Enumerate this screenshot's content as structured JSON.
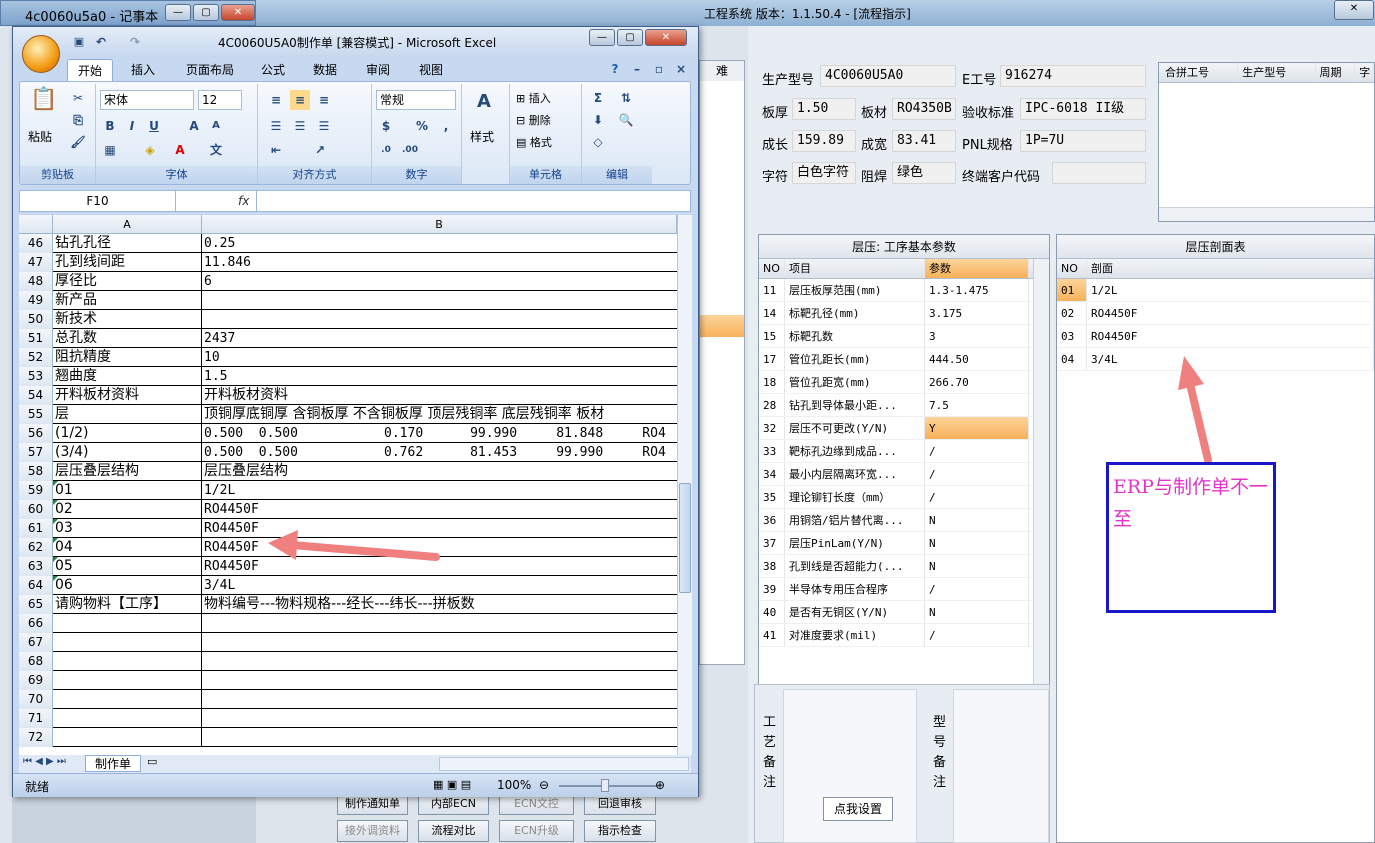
{
  "notepad": {
    "title": "4c0060u5a0 - 记事本"
  },
  "app": {
    "title": "工程系统  版本：1.1.50.4 - [流程指示]"
  },
  "excel": {
    "title": "4C0060U5A0制作单 [兼容模式] - Microsoft Excel",
    "tabs": [
      "开始",
      "插入",
      "页面布局",
      "公式",
      "数据",
      "审阅",
      "视图"
    ],
    "groups": [
      "剪贴板",
      "字体",
      "对齐方式",
      "数字",
      "单元格",
      "编辑"
    ],
    "paste": "粘贴",
    "font": "宋体",
    "font_size": "12",
    "number_format": "常规",
    "styles": "样式",
    "insert": "插入",
    "delete": "删除",
    "format": "格式",
    "name_box": "F10",
    "fx": "fx",
    "col_a": "A",
    "col_b": "B",
    "rows": [
      {
        "n": "46",
        "a": "钻孔孔径",
        "b": "0.25"
      },
      {
        "n": "47",
        "a": "孔到线间距",
        "b": "11.846"
      },
      {
        "n": "48",
        "a": "厚径比",
        "b": "6"
      },
      {
        "n": "49",
        "a": "新产品",
        "b": ""
      },
      {
        "n": "50",
        "a": "新技术",
        "b": ""
      },
      {
        "n": "51",
        "a": "总孔数",
        "b": "2437"
      },
      {
        "n": "52",
        "a": "阻抗精度",
        "b": "10"
      },
      {
        "n": "53",
        "a": "翘曲度",
        "b": "1.5"
      },
      {
        "n": "54",
        "a": "开料板材资料",
        "b": "开料板材资料"
      },
      {
        "n": "55",
        "a": "层",
        "b": "顶铜厚底铜厚 含铜板厚 不含铜板厚 顶层残铜率 底层残铜率 板材"
      },
      {
        "n": "56",
        "a": "(1/2)",
        "b": "0.500  0.500           0.170      99.990     81.848     RO4"
      },
      {
        "n": "57",
        "a": "(3/4)",
        "b": "0.500  0.500           0.762      81.453     99.990     RO4"
      },
      {
        "n": "58",
        "a": "层压叠层结构",
        "b": "层压叠层结构"
      },
      {
        "n": "59",
        "a": "01",
        "b": "1/2L"
      },
      {
        "n": "60",
        "a": "02",
        "b": "RO4450F"
      },
      {
        "n": "61",
        "a": "03",
        "b": "RO4450F"
      },
      {
        "n": "62",
        "a": "04",
        "b": "RO4450F"
      },
      {
        "n": "63",
        "a": "05",
        "b": "RO4450F"
      },
      {
        "n": "64",
        "a": "06",
        "b": "3/4L"
      },
      {
        "n": "65",
        "a": "请购物料【工序】",
        "b": "物料编号---物料规格---经长---纬长---拼板数"
      },
      {
        "n": "66",
        "a": "",
        "b": ""
      },
      {
        "n": "67",
        "a": "",
        "b": ""
      },
      {
        "n": "68",
        "a": "",
        "b": ""
      },
      {
        "n": "69",
        "a": "",
        "b": ""
      },
      {
        "n": "70",
        "a": "",
        "b": ""
      },
      {
        "n": "71",
        "a": "",
        "b": ""
      },
      {
        "n": "72",
        "a": "",
        "b": ""
      }
    ],
    "sheet_tab": "制作单",
    "status": "就绪",
    "zoom": "100%"
  },
  "eng": {
    "fields": {
      "model_l": "生产型号",
      "model_v": "4C0060U5A0",
      "emp_l": "E工号",
      "emp_v": "916274",
      "thick_l": "板厚",
      "thick_v": "1.50",
      "mat_l": "板材",
      "mat_v": "RO4350B",
      "std_l": "验收标准",
      "std_v": "IPC-6018 II级",
      "len_l": "成长",
      "len_v": "159.89",
      "wid_l": "成宽",
      "wid_v": "83.41",
      "pnl_l": "PNL规格",
      "pnl_v": "1P=7U",
      "char_l": "字符",
      "char_v": "白色字符",
      "mask_l": "阻焊",
      "mask_v": "绿色",
      "cust_l": "终端客户代码",
      "cust_v": ""
    },
    "top_grid_headers": [
      "合拼工号",
      "生产型号",
      "周期",
      "字"
    ],
    "params": {
      "title": "层压: 工序基本参数",
      "headers": [
        "NO",
        "项目",
        "参数"
      ],
      "rows": [
        {
          "no": "11",
          "item": "层压板厚范围(mm)",
          "val": "1.3-1.475"
        },
        {
          "no": "14",
          "item": "标靶孔径(mm)",
          "val": "3.175"
        },
        {
          "no": "15",
          "item": "标靶孔数",
          "val": "3"
        },
        {
          "no": "17",
          "item": "管位孔距长(mm)",
          "val": "444.50"
        },
        {
          "no": "18",
          "item": "管位孔距宽(mm)",
          "val": "266.70"
        },
        {
          "no": "28",
          "item": "钻孔到导体最小距...",
          "val": "7.5"
        },
        {
          "no": "32",
          "item": "层压不可更改(Y/N)",
          "val": "Y"
        },
        {
          "no": "33",
          "item": "靶标孔边缘到成品...",
          "val": "/"
        },
        {
          "no": "34",
          "item": "最小内层隔离环宽...",
          "val": "/"
        },
        {
          "no": "35",
          "item": "理论铆钉长度（mm）",
          "val": "/"
        },
        {
          "no": "36",
          "item": "用铜箔/铝片替代离...",
          "val": "N"
        },
        {
          "no": "37",
          "item": "层压PinLam(Y/N)",
          "val": "N"
        },
        {
          "no": "38",
          "item": "孔到线是否超能力(...",
          "val": "N"
        },
        {
          "no": "39",
          "item": "半导体专用压合程序",
          "val": "/"
        },
        {
          "no": "40",
          "item": "是否有无铜区(Y/N)",
          "val": "N"
        },
        {
          "no": "41",
          "item": "对准度要求(mil)",
          "val": "/"
        }
      ]
    },
    "stack": {
      "title": "层压剖面表",
      "headers": [
        "NO",
        "剖面"
      ],
      "rows": [
        {
          "no": "01",
          "val": "1/2L"
        },
        {
          "no": "02",
          "val": "RO4450F"
        },
        {
          "no": "03",
          "val": "RO4450F"
        },
        {
          "no": "04",
          "val": "3/4L"
        }
      ]
    },
    "process_note": "工艺备注",
    "model_note": "型号备注",
    "set_btn": "点我设置",
    "buttons": [
      "制作通知单",
      "内部ECN",
      "ECN文控",
      "回退审核",
      "接外调资料",
      "流程对比",
      "ECN升级",
      "指示检查"
    ],
    "left_col": "难"
  },
  "annotation": "ERP与制作单不一至",
  "colors": {
    "arrow": "#f08080",
    "note_border": "#1717c9",
    "note_text": "#e234c8",
    "orange": "#f8b15a"
  }
}
